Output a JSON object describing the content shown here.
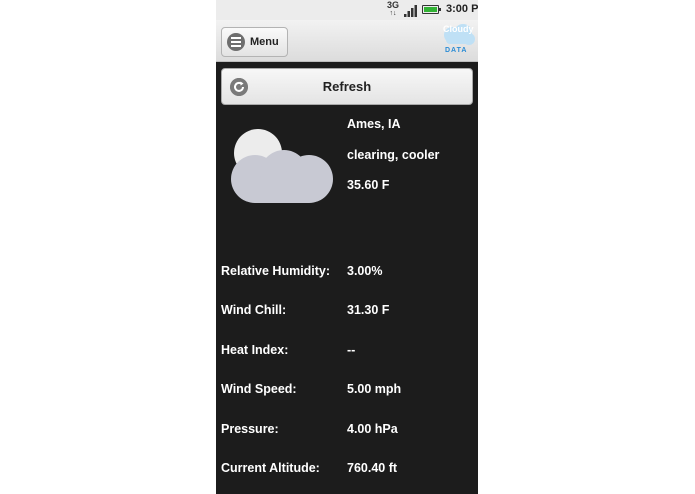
{
  "status_bar": {
    "network": "3G",
    "time": "3:00 P"
  },
  "header": {
    "menu_label": "Menu",
    "logo_text": "Cloudy",
    "logo_sub": "DATA"
  },
  "refresh": {
    "label": "Refresh"
  },
  "weather": {
    "icon": "partly-cloudy-icon",
    "location": "Ames, IA",
    "condition": "clearing, cooler",
    "temperature": "35.60 F"
  },
  "details": [
    {
      "label": "Relative Humidity:",
      "value": "3.00%"
    },
    {
      "label": "Wind Chill:",
      "value": "31.30 F"
    },
    {
      "label": "Heat Index:",
      "value": "--"
    },
    {
      "label": "Wind Speed:",
      "value": "5.00 mph"
    },
    {
      "label": "Pressure:",
      "value": "4.00 hPa"
    },
    {
      "label": "Current Altitude:",
      "value": "760.40 ft"
    }
  ],
  "colors": {
    "background": "#1c1c1c",
    "text": "#ffffff",
    "battery": "#31b234",
    "cloud": "#c8c9d3",
    "sun": "#ececec"
  }
}
